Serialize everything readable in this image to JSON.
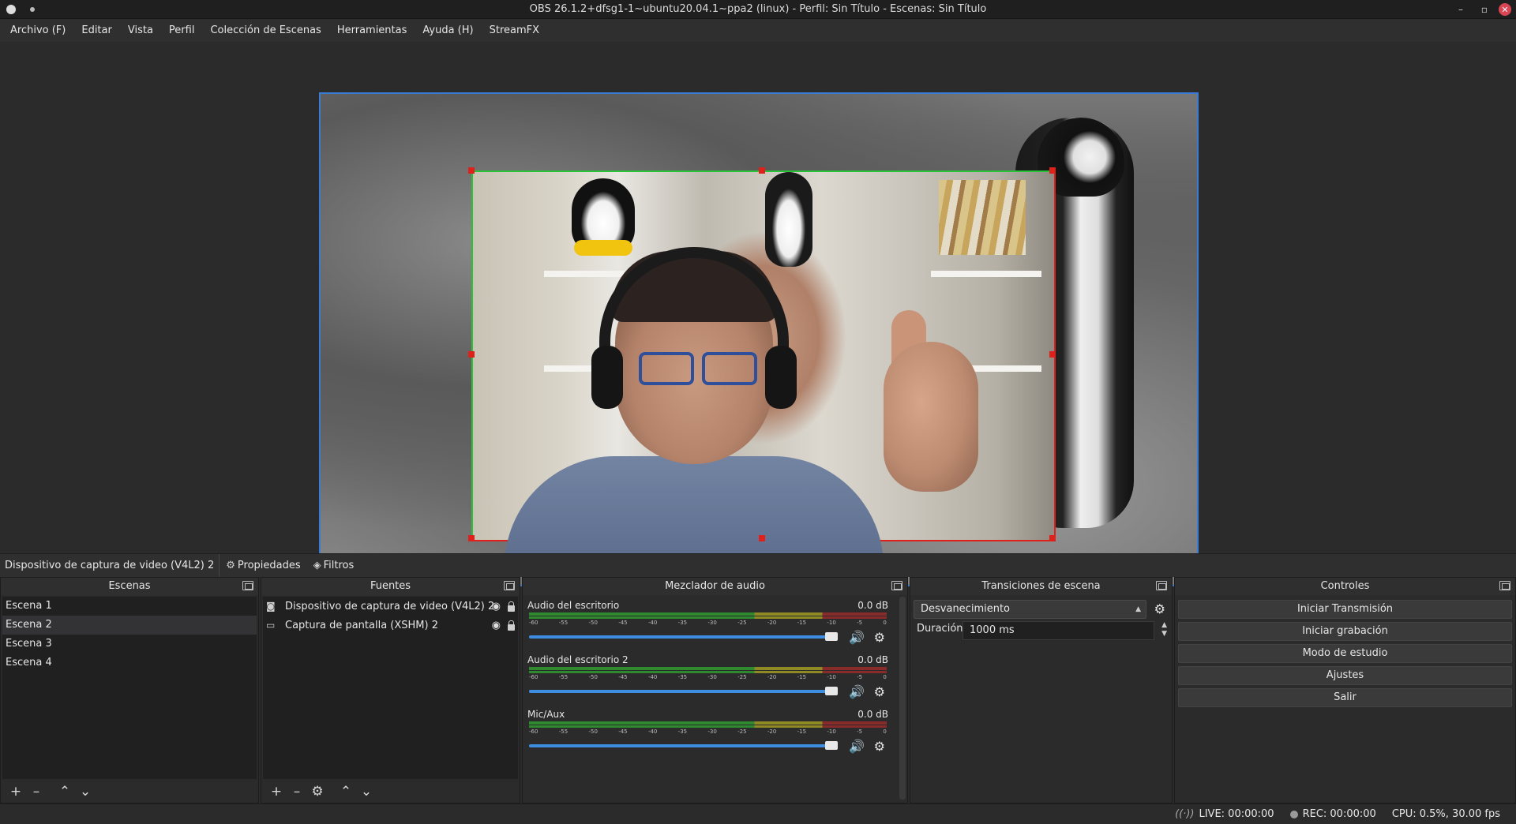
{
  "window": {
    "title": "OBS 26.1.2+dfsg1-1~ubuntu20.04.1~ppa2 (linux) - Perfil: Sin Título - Escenas: Sin Título"
  },
  "menu": [
    "Archivo (F)",
    "Editar",
    "Vista",
    "Perfil",
    "Colección de Escenas",
    "Herramientas",
    "Ayuda (H)",
    "StreamFX"
  ],
  "source_bar": {
    "selected": "Dispositivo de captura de video (V4L2) 2",
    "properties": "Propiedades",
    "filters": "Filtros"
  },
  "scenes": {
    "title": "Escenas",
    "items": [
      "Escena 1",
      "Escena 2",
      "Escena 3",
      "Escena 4"
    ],
    "selected_index": 1
  },
  "sources": {
    "title": "Fuentes",
    "items": [
      "Dispositivo de captura de video (V4L2) 2",
      "Captura de pantalla (XSHM) 2"
    ]
  },
  "mixer": {
    "title": "Mezclador de audio",
    "channels": [
      {
        "name": "Audio del escritorio",
        "db": "0.0 dB"
      },
      {
        "name": "Audio del escritorio 2",
        "db": "0.0 dB"
      },
      {
        "name": "Mic/Aux",
        "db": "0.0 dB"
      }
    ],
    "ticks": [
      "-60",
      "-55",
      "-50",
      "-45",
      "-40",
      "-35",
      "-30",
      "-25",
      "-20",
      "-15",
      "-10",
      "-5",
      "0"
    ]
  },
  "transitions": {
    "title": "Transiciones de escena",
    "selected": "Desvanecimiento",
    "duration_label": "Duración",
    "duration_value": "1000 ms"
  },
  "controls": {
    "title": "Controles",
    "buttons": [
      "Iniciar Transmisión",
      "Iniciar grabación",
      "Modo de estudio",
      "Ajustes",
      "Salir"
    ]
  },
  "status": {
    "live": "LIVE: 00:00:00",
    "rec": "REC: 00:00:00",
    "cpu": "CPU: 0.5%, 30.00 fps"
  }
}
